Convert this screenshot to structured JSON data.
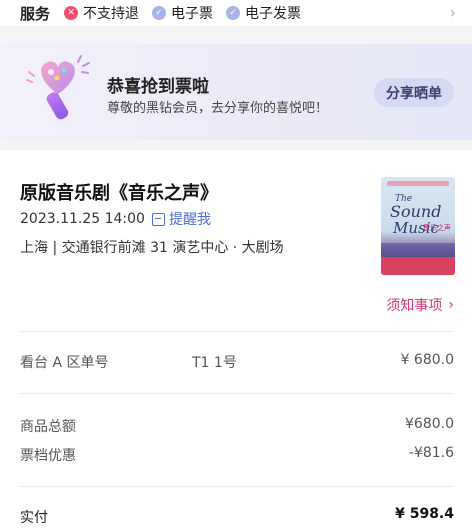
{
  "services": {
    "title": "服务",
    "items": [
      {
        "icon": "x-circle-icon",
        "label": "不支持退",
        "color": "#f0506e"
      },
      {
        "icon": "check-circle-icon",
        "label": "电子票",
        "color": "#a7b3e8"
      },
      {
        "icon": "check-circle-icon",
        "label": "电子发票",
        "color": "#a7b3e8"
      }
    ]
  },
  "banner": {
    "title": "恭喜抢到票啦",
    "subtitle": "尊敬的黑钻会员，去分享你的喜悦吧！",
    "share_label": "分享晒单"
  },
  "ticket": {
    "title": "原版音乐剧《音乐之声》",
    "datetime": "2023.11.25 14:00",
    "remind_label": "提醒我",
    "venue": "上海 | 交通银行前滩 31 演艺中心 · 大剧场",
    "notice_label": "须知事项",
    "poster": {
      "line1": "The",
      "line2": "Sound",
      "line3": "Music",
      "cn": "音乐之声"
    }
  },
  "price_rows": {
    "seat": {
      "label": "看台 A 区单号",
      "seat": "T1 1号",
      "value": "¥ 680.0"
    },
    "subtotal": {
      "label": "商品总额",
      "value": "¥680.0"
    },
    "discount": {
      "label": "票档优惠",
      "value": "-¥81.6"
    },
    "paid": {
      "label": "实付",
      "value": "¥ 598.4"
    }
  },
  "colors": {
    "accent_pink": "#d1397a",
    "link_blue": "#4a6fd8",
    "share_button_bg": "#d5d9f3"
  }
}
